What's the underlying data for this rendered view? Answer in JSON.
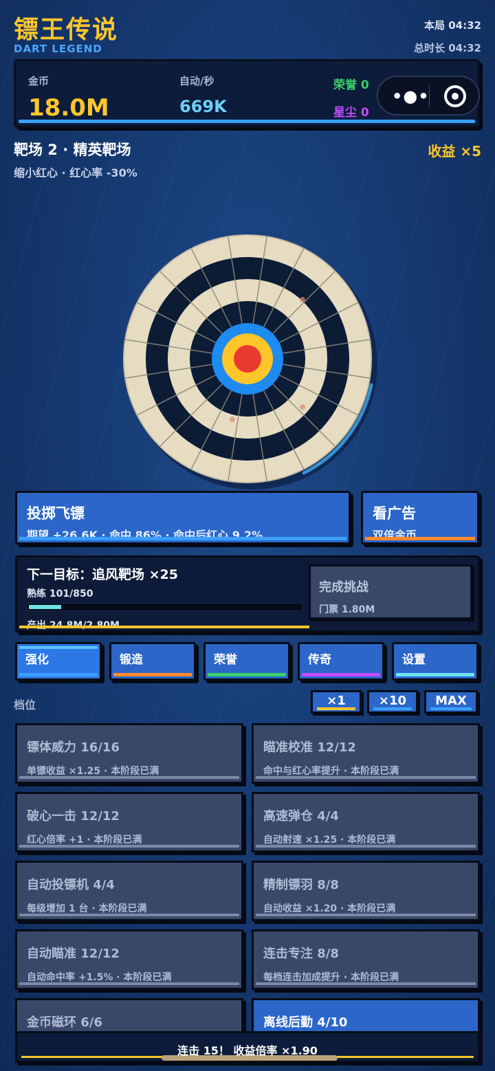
{
  "header": {
    "title": "镖王传说",
    "subtitle": "DART LEGEND",
    "round_time": "本局 04:32",
    "total_time": "总时长 04:32"
  },
  "stats": {
    "coins_label": "金币",
    "coins_value": "18.0M",
    "auto_label": "自动/秒",
    "auto_value": "669K",
    "honor": "荣誉 0",
    "stardust": "星尘 0"
  },
  "range": {
    "title": "靶场 2 · 精英靶场",
    "modifier": "缩小红心 · 红心率 -30%",
    "profit": "收益 ×5"
  },
  "actions": {
    "throw_title": "投掷飞镖",
    "throw_stats": "期望 +26.6K · 命中 86% · 命中后红心 9.2%",
    "ad_title": "看广告",
    "ad_sub": "双倍金币"
  },
  "next_target": {
    "title": "下一目标：追风靶场 ×25",
    "mastery": "熟练 101/850",
    "mastery_progress": 0.119,
    "output": "产出 24.8M/2.80M",
    "challenge_title": "完成挑战",
    "challenge_ticket": "门票 1.80M"
  },
  "tabs": [
    {
      "label": "强化",
      "color": "#3aa0ff"
    },
    {
      "label": "锻造",
      "color": "#ff8a2a"
    },
    {
      "label": "荣誉",
      "color": "#39d26b"
    },
    {
      "label": "传奇",
      "color": "#c44dff"
    },
    {
      "label": "设置",
      "color": "#6fe3f0"
    }
  ],
  "tier": {
    "label": "档位",
    "options": [
      {
        "label": "×1",
        "color": "#ffc62a"
      },
      {
        "label": "×10",
        "color": "#3aa0ff"
      },
      {
        "label": "MAX",
        "color": "#3aa0ff"
      }
    ]
  },
  "upgrades": [
    {
      "title": "镖体威力  16/16",
      "desc": "单镖收益 ×1.25 · 本阶段已满"
    },
    {
      "title": "瞄准校准  12/12",
      "desc": "命中与红心率提升 · 本阶段已满"
    },
    {
      "title": "破心一击  12/12",
      "desc": "红心倍率 +1 · 本阶段已满"
    },
    {
      "title": "高速弹仓  4/4",
      "desc": "自动射速 ×1.25 · 本阶段已满"
    },
    {
      "title": "自动投镖机  4/4",
      "desc": "每级增加 1 台 · 本阶段已满"
    },
    {
      "title": "精制镖羽  8/8",
      "desc": "自动收益 ×1.20 · 本阶段已满"
    },
    {
      "title": "自动瞄准  12/12",
      "desc": "自动命中率 +1.5% · 本阶段已满"
    },
    {
      "title": "连击专注  8/8",
      "desc": "每档连击加成提升 · 本阶段已满"
    },
    {
      "title": "金币磁环  6/6",
      "desc": ""
    },
    {
      "title": "离线后勤  4/10",
      "desc": ""
    }
  ],
  "combo": {
    "text": "连击 15！ 收益倍率 ×1.90"
  },
  "colors": {
    "accent_gold": "#ffc62a",
    "accent_blue": "#3aa0ff",
    "bullseye_red": "#e93a2f"
  }
}
